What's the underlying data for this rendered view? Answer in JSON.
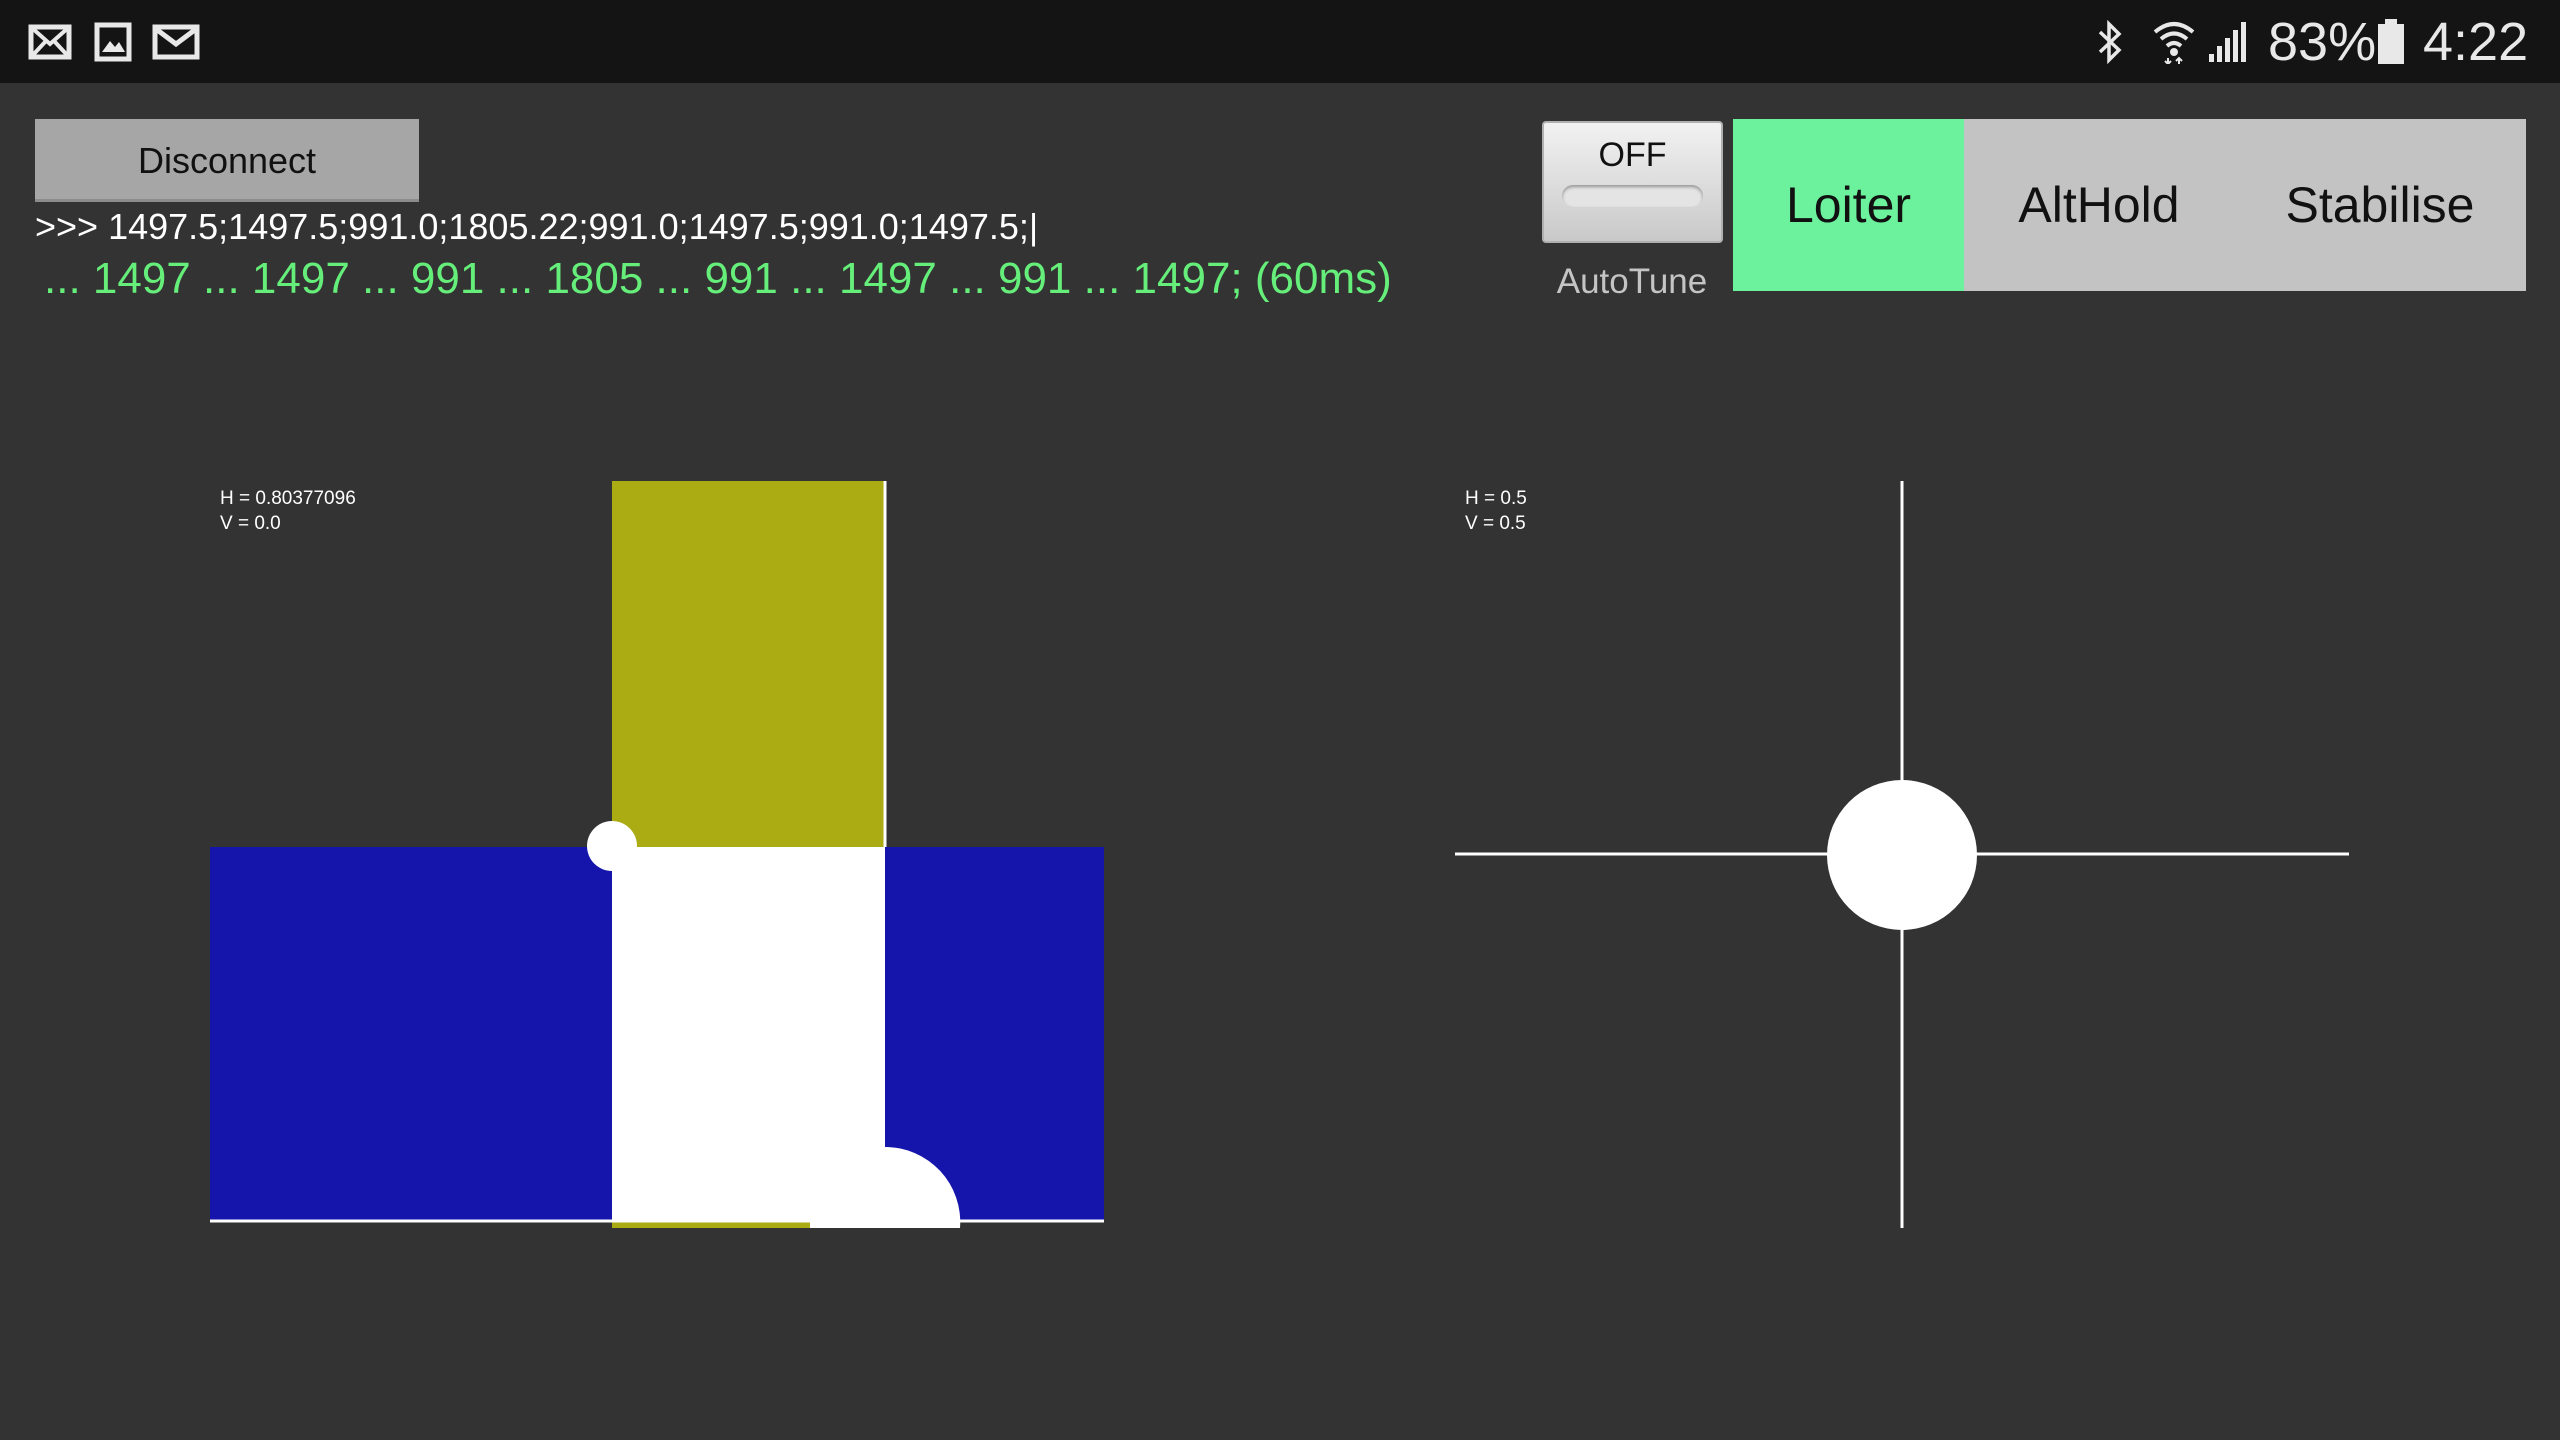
{
  "status_bar": {
    "notification_icons": [
      "mail-icon",
      "image-icon",
      "email-icon"
    ],
    "system_icons": [
      "bluetooth-icon",
      "wifi-icon",
      "signal-icon",
      "battery-icon"
    ],
    "battery": "83%",
    "time": "4:22"
  },
  "controls": {
    "disconnect_label": "Disconnect",
    "raw_line": ">>> 1497.5;1497.5;991.0;1805.22;991.0;1497.5;991.0;1497.5;|",
    "parsed_line": "... 1497 ... 1497 ... 991 ... 1805 ... 991 ... 1497 ... 991 ... 1497; (60ms)",
    "autotune": {
      "state_label": "OFF",
      "caption": "AutoTune"
    },
    "modes": [
      {
        "label": "Loiter",
        "active": true
      },
      {
        "label": "AltHold",
        "active": false
      },
      {
        "label": "Stabilise",
        "active": false
      }
    ]
  },
  "left_stick": {
    "h_label": "H = 0.80377096",
    "v_label": "V = 0.0",
    "h": 0.80377096,
    "v": 0.0
  },
  "right_stick": {
    "h_label": "H = 0.5",
    "v_label": "V = 0.5",
    "h": 0.5,
    "v": 0.5
  },
  "colors": {
    "background": "#333333",
    "status_bar": "#141414",
    "parsed_text": "#66ee7a",
    "active_mode": "#6cf29c",
    "mode_bar": "#c3c3c3",
    "vertical_bar": "#abab14",
    "horizontal_bar": "#1515ab",
    "white": "#ffffff"
  }
}
